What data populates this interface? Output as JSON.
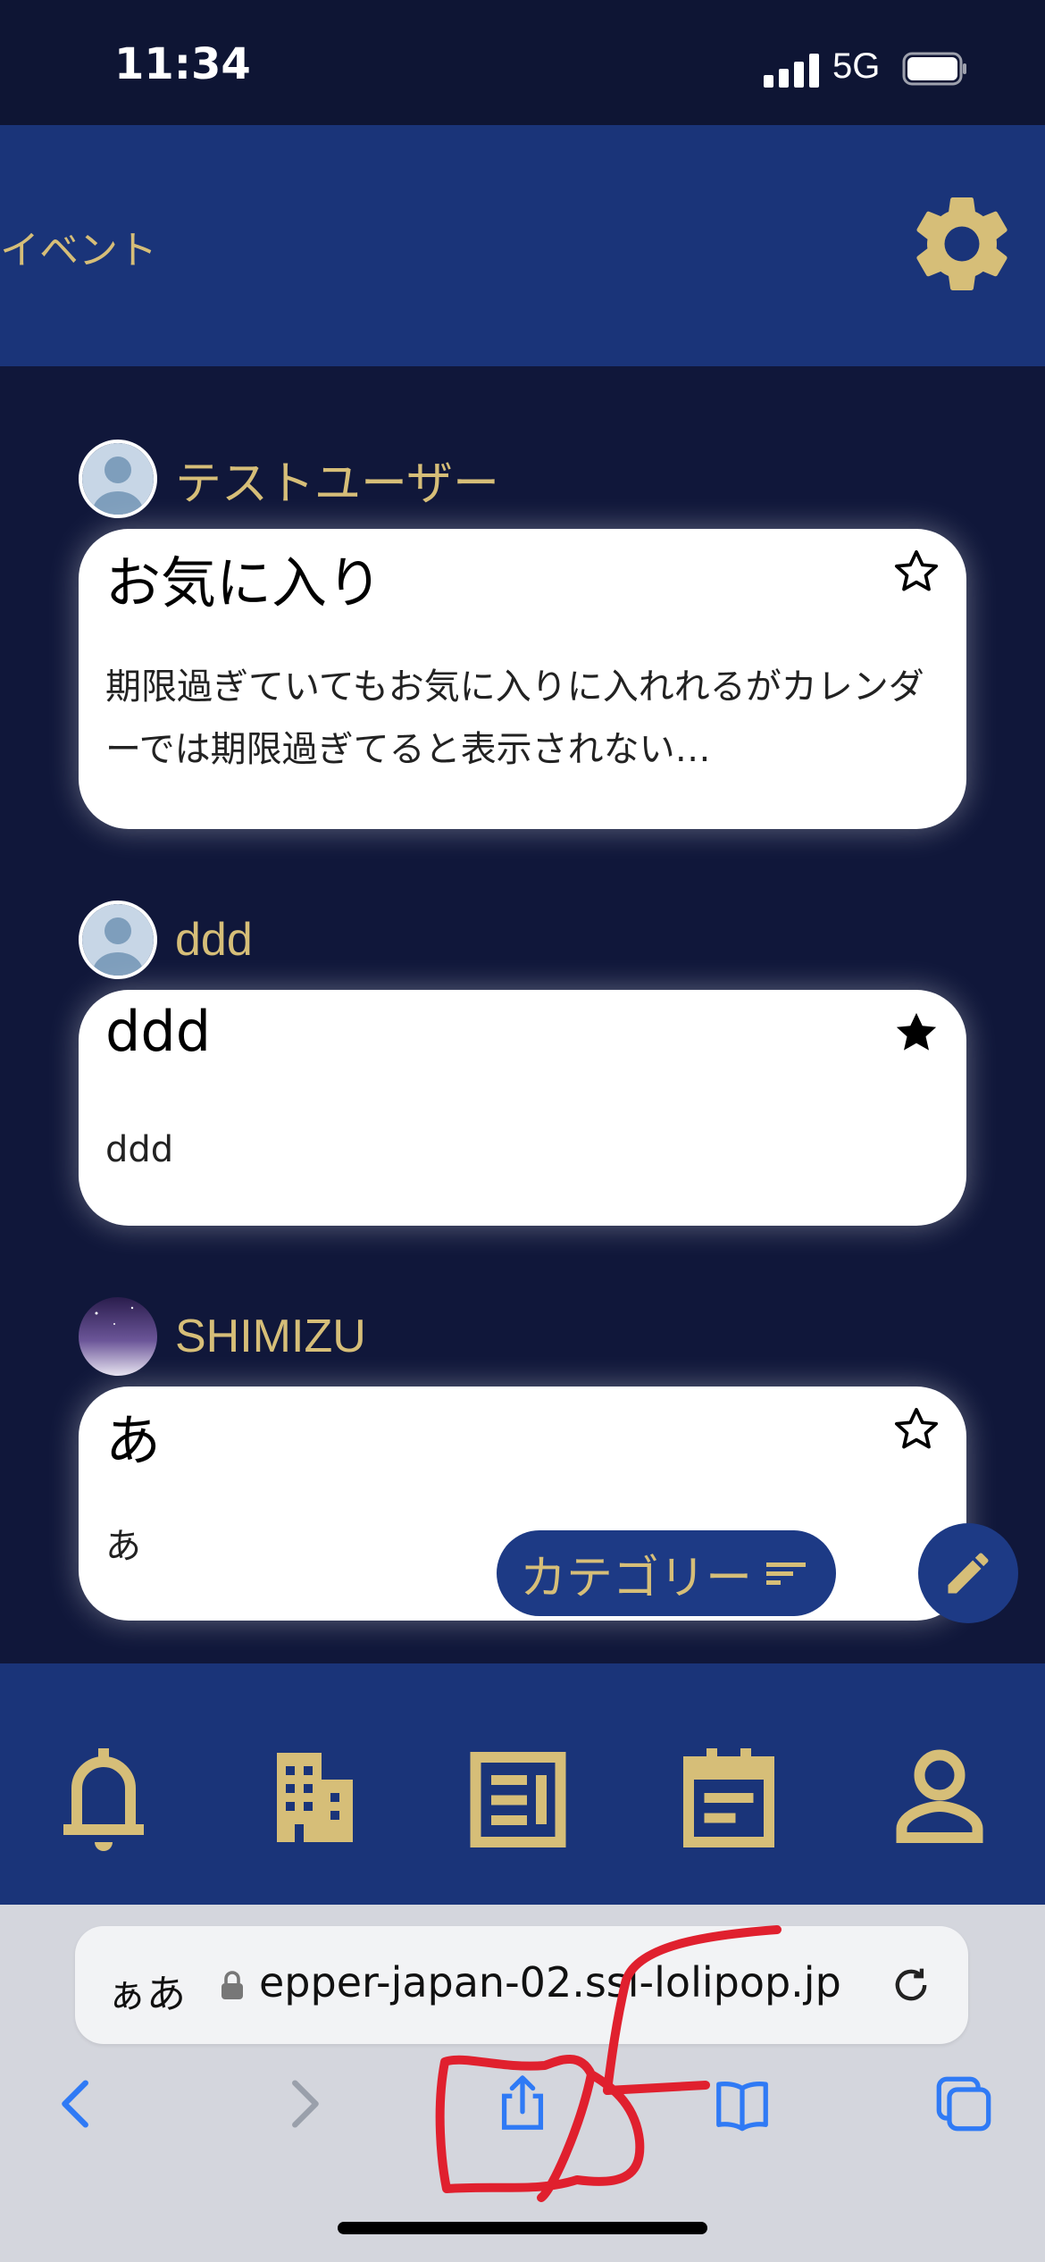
{
  "status_bar": {
    "time": "11:34",
    "network": "5G"
  },
  "header": {
    "title": "イベント",
    "settings_icon": "gear-icon"
  },
  "posts": [
    {
      "user": "テストユーザー",
      "title": "お気に入り",
      "body": "期限過ぎていてもお気に入りに入れれるがカレンダーでは期限過ぎてると表示されない…",
      "favorited": false
    },
    {
      "user": "ddd",
      "title": "ddd",
      "body": "ddd",
      "favorited": true
    },
    {
      "user": "SHIMIZU",
      "title": "あ",
      "body": "あ",
      "favorited": false
    }
  ],
  "category_button": {
    "label": "カテゴリー",
    "icon": "filter-lines-icon"
  },
  "compose_button": {
    "icon": "pencil-icon"
  },
  "bottom_nav": {
    "items": [
      {
        "icon": "bell-icon"
      },
      {
        "icon": "building-icon"
      },
      {
        "icon": "news-icon"
      },
      {
        "icon": "calendar-icon"
      },
      {
        "icon": "person-icon"
      }
    ]
  },
  "browser": {
    "aa_label": "ぁあ",
    "url": "epper-japan-02.ssl-lolipop.jp",
    "toolbar": [
      "back-icon",
      "forward-icon",
      "share-icon",
      "bookmarks-icon",
      "tabs-icon"
    ]
  },
  "colors": {
    "accent": "#d6be78",
    "header_bg": "#1a3479",
    "page_bg": "#10173a",
    "annotation": "#e0202e"
  }
}
